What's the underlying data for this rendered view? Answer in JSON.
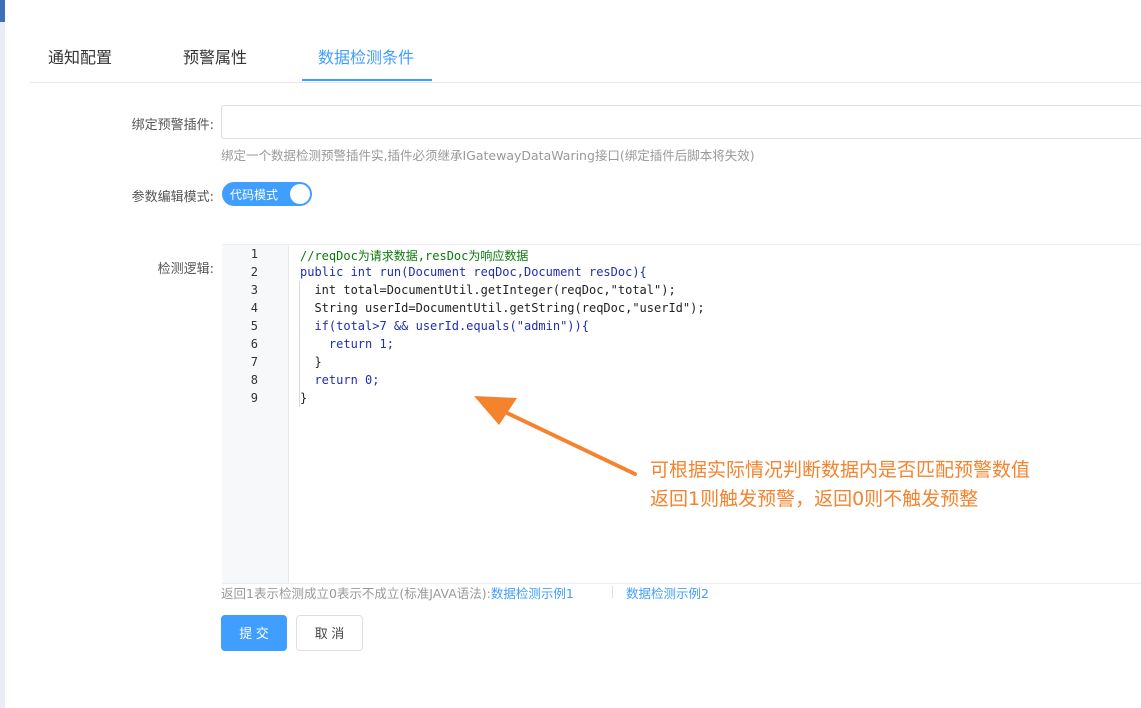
{
  "tabs": [
    {
      "label": "通知配置"
    },
    {
      "label": "预警属性"
    },
    {
      "label": "数据检测条件",
      "active": true
    }
  ],
  "form": {
    "plugin": {
      "label": "绑定预警插件:",
      "value": "",
      "hint": "绑定一个数据检测预警插件实,插件必须继承IGatewayDataWaring接口(绑定插件后脚本将失效)"
    },
    "mode": {
      "label": "参数编辑模式:",
      "switch_text": "代码模式",
      "on": true
    },
    "logic": {
      "label": "检测逻辑:"
    }
  },
  "editor": {
    "line_numbers": [
      "1",
      "2",
      "3",
      "4",
      "5",
      "6",
      "7",
      "8",
      "9"
    ],
    "lines": [
      "//reqDoc为请求数据,resDoc为响应数据",
      "public int run(Document reqDoc,Document resDoc){",
      "  int total=DocumentUtil.getInteger(reqDoc,\"total\");",
      "  String userId=DocumentUtil.getString(reqDoc,\"userId\");",
      "  if(total>7 && userId.equals(\"admin\")){",
      "    return 1;",
      "  }",
      "  return 0;",
      "}"
    ]
  },
  "annotation": {
    "line1": "可根据实际情况判断数据内是否匹配预警数值",
    "line2": "返回1则触发预警，返回0则不触发预整",
    "color": "#f5832e"
  },
  "footer": {
    "desc": "返回1表示检测成立0表示不成立(标准JAVA语法):",
    "link1": "数据检测示例1",
    "link2": "数据检测示例2"
  },
  "buttons": {
    "submit": "提 交",
    "cancel": "取 消"
  },
  "colors": {
    "accent": "#409eff",
    "annotation": "#f5832e"
  }
}
